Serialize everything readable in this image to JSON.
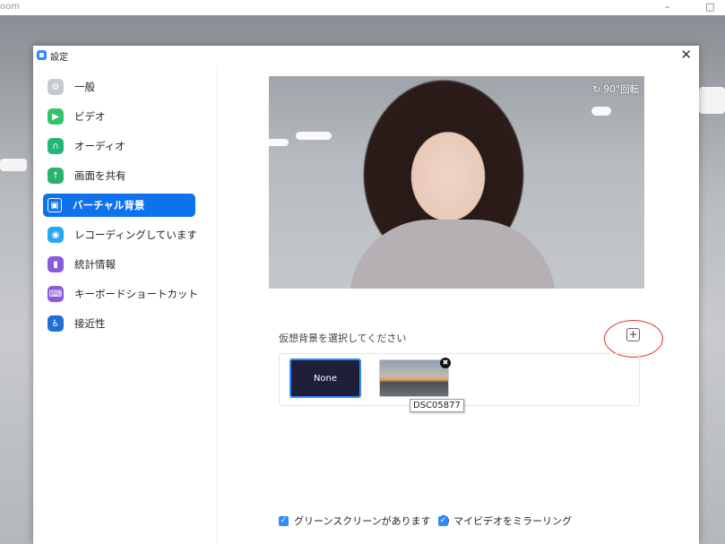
{
  "background_window": {
    "title": "oom",
    "minimize_icon": "minimize-icon",
    "maximize_icon": "maximize-icon",
    "minimize_glyph": "–",
    "maximize_glyph": "□"
  },
  "dialog": {
    "title": "設定",
    "close_glyph": "✕"
  },
  "sidebar": {
    "items": [
      {
        "label": "一般",
        "icon": "gear-icon",
        "color": "#c7cbd1",
        "glyph": "⚙"
      },
      {
        "label": "ビデオ",
        "icon": "video-icon",
        "color": "#30c56b",
        "glyph": "▶"
      },
      {
        "label": "オーディオ",
        "icon": "headphones-icon",
        "color": "#25b47a",
        "glyph": "∩"
      },
      {
        "label": "画面を共有",
        "icon": "share-screen-icon",
        "color": "#29b36b",
        "glyph": "↑"
      },
      {
        "label": "バーチャル背景",
        "icon": "virtual-background-icon",
        "color": "#0e72ed",
        "glyph": "▣",
        "active": true
      },
      {
        "label": "レコーディングしています",
        "icon": "recording-icon",
        "color": "#2ba6f5",
        "glyph": "◉"
      },
      {
        "label": "統計情報",
        "icon": "statistics-icon",
        "color": "#8a5cd8",
        "glyph": "▮"
      },
      {
        "label": "キーボードショートカット",
        "icon": "keyboard-icon",
        "color": "#8a5cd8",
        "glyph": "⌨"
      },
      {
        "label": "接近性",
        "icon": "accessibility-icon",
        "color": "#1f6fd6",
        "glyph": "♿"
      }
    ]
  },
  "preview": {
    "rotate_label": "↻ 90°回転"
  },
  "virtual_background": {
    "label": "仮想背景を選択してください",
    "add_glyph": "+",
    "none_label": "None",
    "remove_glyph": "✖",
    "image_tooltip": "DSC05877"
  },
  "options": {
    "green_screen_label": "グリーンスクリーンがあります",
    "green_screen_checked": true,
    "help_glyph": "?",
    "mirror_label": "マイビデオをミラーリング",
    "mirror_checked": true,
    "check_glyph": "✓"
  },
  "colors": {
    "accent": "#0e72ed",
    "highlight_circle": "#e0302a"
  }
}
